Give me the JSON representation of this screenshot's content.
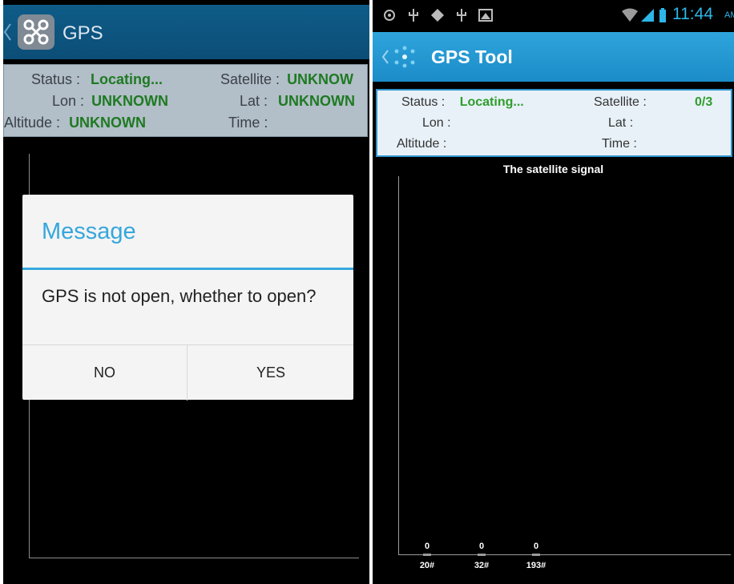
{
  "left_screen": {
    "header": {
      "title": "GPS"
    },
    "info": {
      "status_label": "Status :",
      "status_value": "Locating...",
      "satellite_label": "Satellite :",
      "satellite_value": "UNKNOW",
      "lon_label": "Lon :",
      "lon_value": "UNKNOWN",
      "lat_label": "Lat :",
      "lat_value": "UNKNOWN",
      "altitude_label": "Altitude :",
      "altitude_value": "UNKNOWN",
      "time_label": "Time :",
      "time_value": ""
    },
    "dialog": {
      "title": "Message",
      "message": "GPS is not open, whether to open?",
      "no_label": "NO",
      "yes_label": "YES"
    }
  },
  "right_screen": {
    "status_bar": {
      "time": "11:44",
      "ampm": "AM",
      "icons": [
        "gps-icon",
        "usb-icon",
        "android-debug-icon",
        "usb-icon",
        "gallery-icon",
        "wifi-icon",
        "signal-icon",
        "battery-icon"
      ]
    },
    "header": {
      "title": "GPS Tool"
    },
    "info": {
      "status_label": "Status :",
      "status_value": "Locating...",
      "satellite_label": "Satellite :",
      "satellite_value": "0/3",
      "lon_label": "Lon :",
      "lon_value": "",
      "lat_label": "Lat :",
      "lat_value": "",
      "altitude_label": "Altitude :",
      "altitude_value": "",
      "time_label": "Time :",
      "time_value": ""
    },
    "chart_data": {
      "type": "bar",
      "title": "The satellite signal",
      "categories": [
        "20#",
        "32#",
        "193#"
      ],
      "values": [
        0,
        0,
        0
      ],
      "xlabel": "",
      "ylabel": ""
    }
  },
  "colors": {
    "accent": "#35a7dc",
    "value_green": "#2f9e2c",
    "left_header": "#0f5c88",
    "right_header": "#2fa4dc"
  }
}
